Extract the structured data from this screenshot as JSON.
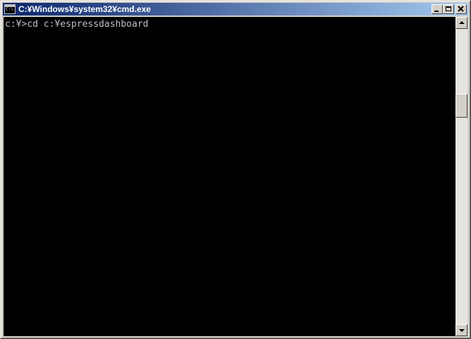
{
  "window": {
    "title": "C:¥Windows¥system32¥cmd.exe",
    "icon": "cmd-icon",
    "icon_text": "C:\\",
    "controls": [
      "minimize",
      "maximize",
      "close"
    ]
  },
  "console": {
    "lines": [
      "c:¥>cd c:¥espressdashboard"
    ],
    "text_color": "#c0c0c0",
    "background_color": "#000000"
  },
  "scrollbar": {
    "position_fraction": 0.24
  },
  "colors": {
    "titlebar_start": "#0a246a",
    "titlebar_end": "#a6caf0",
    "chrome": "#d4d0c8"
  }
}
